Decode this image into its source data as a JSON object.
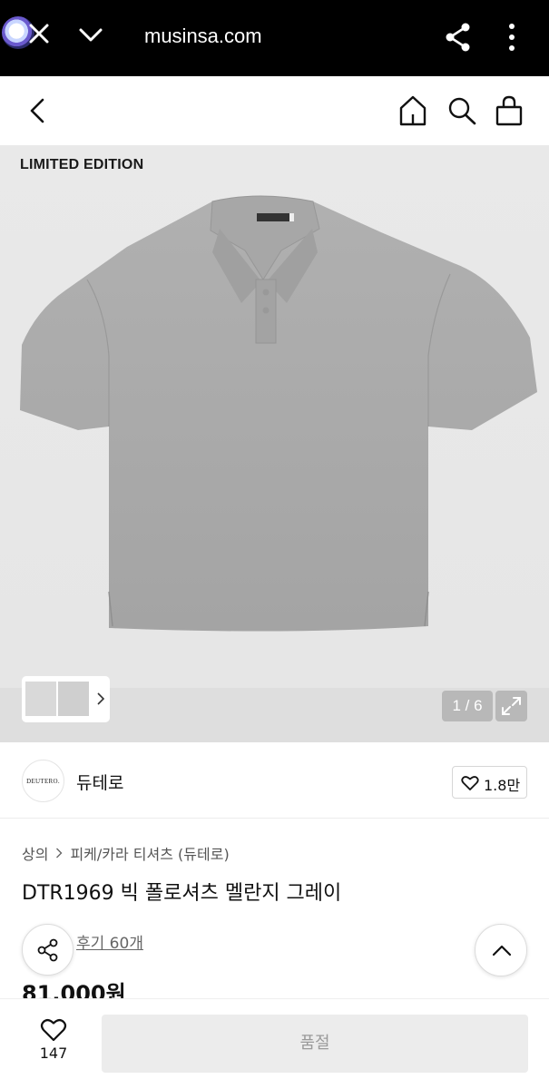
{
  "browser": {
    "url": "musinsa.com"
  },
  "hero": {
    "badge": "LIMITED EDITION",
    "counter": "1 / 6"
  },
  "brand": {
    "name": "듀테로",
    "logo_text": "DEUTERO.",
    "like_count": "1.8만"
  },
  "product": {
    "breadcrumb": [
      "상의",
      "피케/카라 티셔츠 (듀테로)"
    ],
    "title": "DTR1969 빅 폴로셔츠 멜란지 그레이",
    "reviews": "후기 60개",
    "price": "81,000원"
  },
  "bottom": {
    "wish_count": "147",
    "action_label": "품절"
  },
  "colors": {
    "top_bar": "#000000",
    "image_bg": "#e7e7e7",
    "shirt": "#a9a9a9",
    "soldout_bg": "#ececec"
  },
  "icons": [
    "close-icon",
    "chevron-down-icon",
    "share-icon",
    "more-icon",
    "back-icon",
    "home-icon",
    "search-icon",
    "bag-icon",
    "heart-icon",
    "expand-icon",
    "arrow-up-icon"
  ]
}
